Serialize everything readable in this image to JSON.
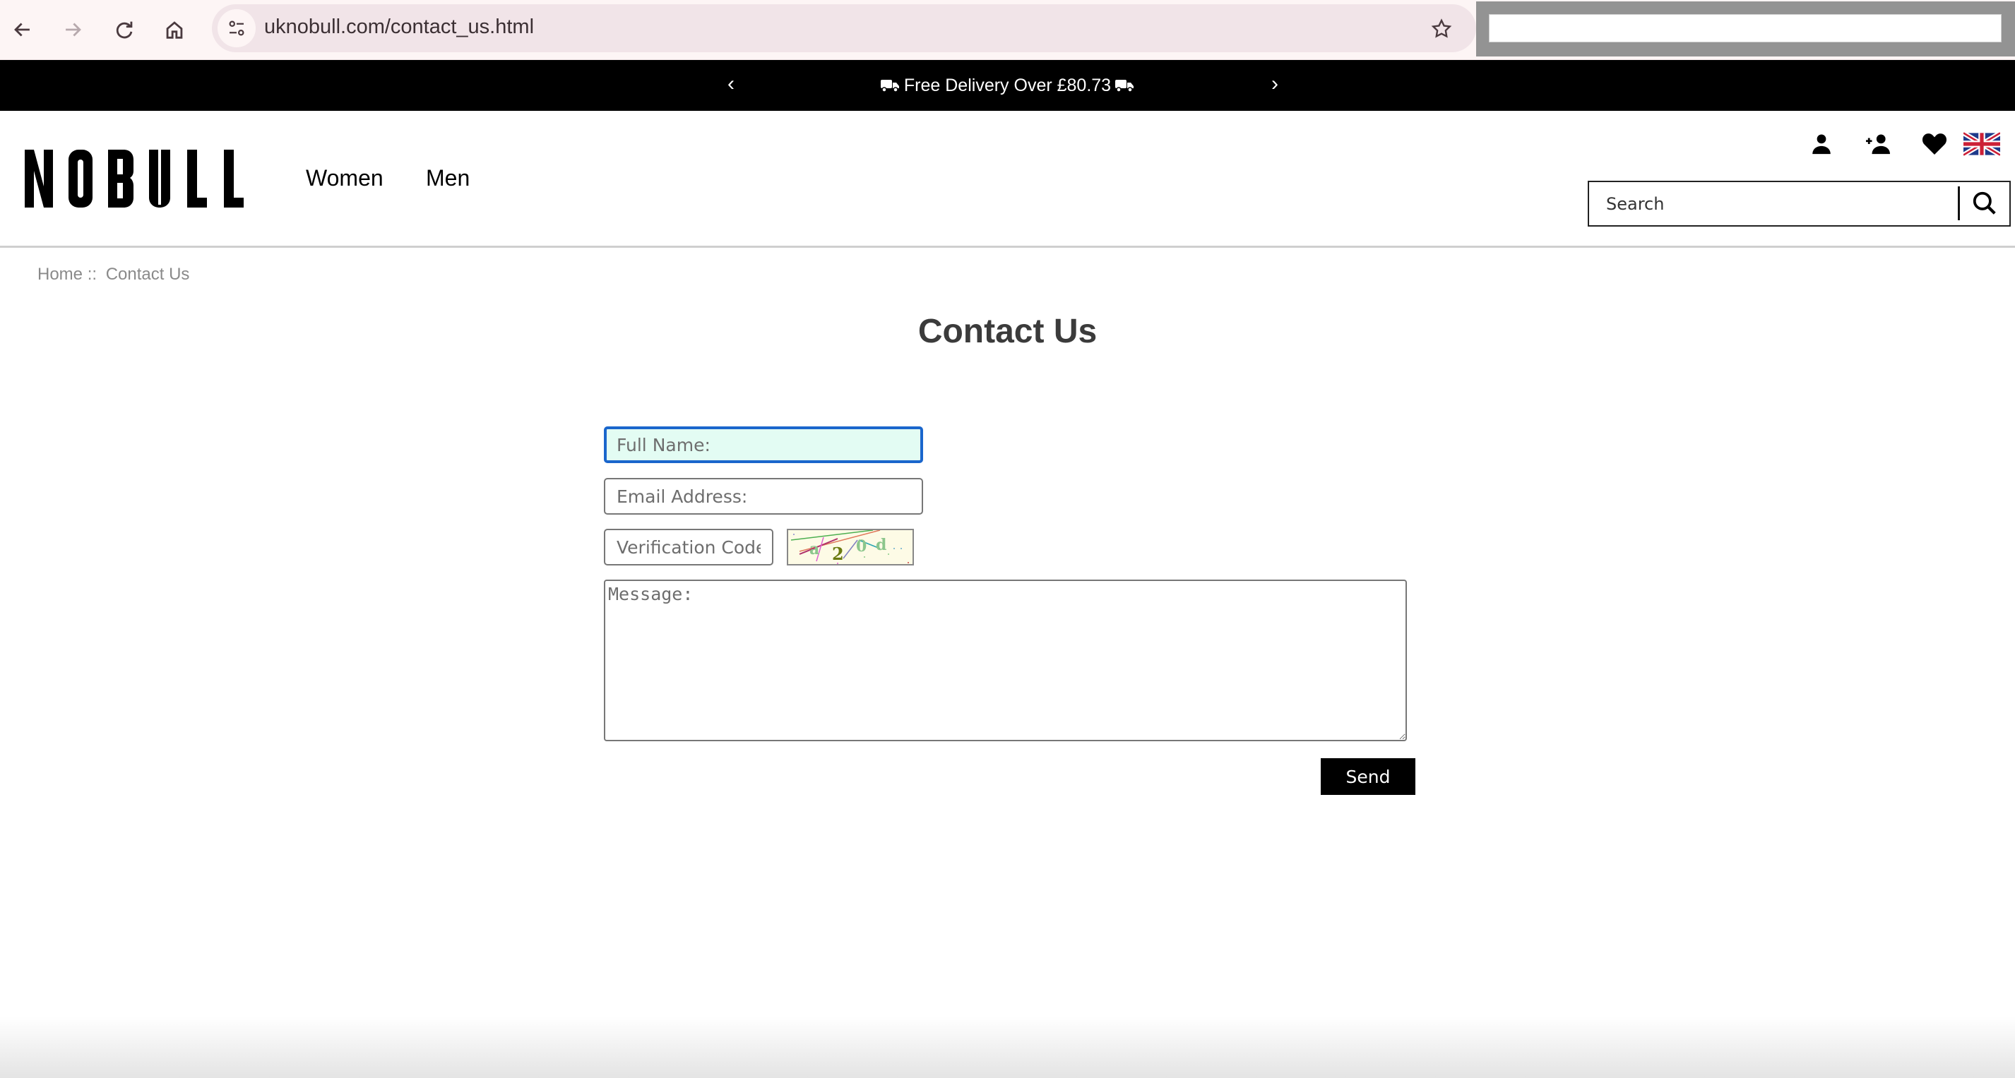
{
  "browser": {
    "url": "uknobull.com/contact_us.html",
    "icons": [
      "back-icon",
      "forward-icon",
      "reload-icon",
      "home-icon",
      "site-info-icon",
      "bookmark-star-icon"
    ]
  },
  "announcement": {
    "text": "Free Delivery Over £80.73",
    "prev_arrow": "‹",
    "next_arrow": "›"
  },
  "header": {
    "logo_text": "NOBULL",
    "nav": [
      {
        "label": "Women"
      },
      {
        "label": "Men"
      }
    ],
    "icons": [
      "account-icon",
      "register-icon",
      "wishlist-heart-icon",
      "uk-flag-icon"
    ],
    "search": {
      "placeholder": "Search"
    }
  },
  "breadcrumb": {
    "home": "Home",
    "separator": "::",
    "current": "Contact Us"
  },
  "page_title": "Contact Us",
  "form": {
    "full_name": {
      "placeholder": "Full Name:",
      "value": ""
    },
    "email": {
      "placeholder": "Email Address:",
      "value": ""
    },
    "verification": {
      "placeholder": "Verification Code",
      "value": ""
    },
    "captcha_text": "a2/0d",
    "message": {
      "placeholder": "Message:",
      "value": ""
    },
    "send_label": "Send"
  },
  "colors": {
    "focus_border": "#1a66cc",
    "focus_bg": "#e3fcf3",
    "banner_bg": "#000000",
    "title_color": "#3b3b3b"
  }
}
